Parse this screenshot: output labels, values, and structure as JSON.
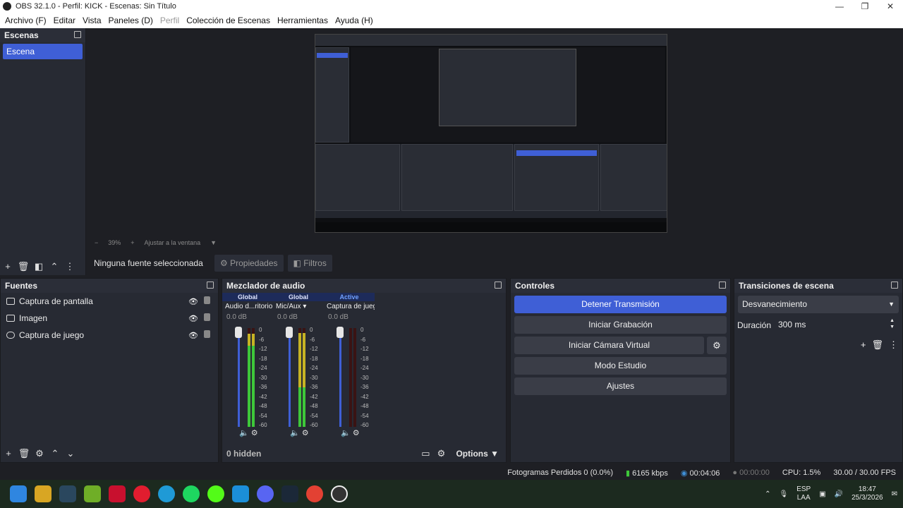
{
  "window": {
    "title": "OBS 32.1.0 - Perfil: KICK - Escenas: Sin Título",
    "controls": [
      "—",
      "❐",
      "✕"
    ]
  },
  "menu": [
    "Archivo (F)",
    "Editar",
    "Vista",
    "Paneles (D)",
    "Perfil",
    "Colección de Escenas",
    "Herramientas",
    "Ayuda (H)"
  ],
  "scenes": {
    "title": "Escenas",
    "items": [
      "Escena"
    ]
  },
  "zoom": {
    "value": "39%",
    "fit_label": "Ajustar a la ventana"
  },
  "sourcebar": {
    "no_source": "Ninguna fuente seleccionada",
    "properties": "Propiedades",
    "filters": "Filtros"
  },
  "sources": {
    "title": "Fuentes",
    "items": [
      "Captura de pantalla",
      "Imagen",
      "Captura de juego"
    ]
  },
  "mixer": {
    "title": "Mezclador de audio",
    "channels": [
      {
        "tag": "Global",
        "name": "Audio d...ritorio",
        "db": "0.0 dB",
        "level_green": 0.82,
        "level_yellow": 0.12
      },
      {
        "tag": "Global",
        "name": "Mic/Aux",
        "db": "0.0 dB",
        "level_green": 0.4,
        "level_yellow": 0.55
      },
      {
        "tag": "Active",
        "name": "Captura de juego",
        "db": "0.0 dB",
        "level_green": 0.0,
        "level_yellow": 0.0
      }
    ],
    "scale": [
      "0",
      "-6",
      "-12",
      "-18",
      "-24",
      "-30",
      "-36",
      "-42",
      "-48",
      "-54",
      "-60"
    ],
    "hidden": "0 hidden",
    "options": "Options"
  },
  "controls": {
    "title": "Controles",
    "stop_stream": "Detener Transmisión",
    "start_recording": "Iniciar Grabación",
    "virtual_cam": "Iniciar Cámara Virtual",
    "studio_mode": "Modo Estudio",
    "settings": "Ajustes"
  },
  "transitions": {
    "title": "Transiciones de escena",
    "selected": "Desvanecimiento",
    "duration_label": "Duración",
    "duration_value": "300 ms"
  },
  "status": {
    "dropped": "Fotogramas Perdidos 0 (0.0%)",
    "bitrate": "6165 kbps",
    "stream_time": "00:04:06",
    "rec_time": "00:00:00",
    "cpu": "CPU: 1.5%",
    "fps": "30.00 / 30.00 FPS"
  },
  "tray": {
    "lang_top": "ESP",
    "lang_bottom": "LAA",
    "time": "18:47",
    "date": "25/3/2026"
  },
  "colors": {
    "accent": "#3f5fd6",
    "panel": "#272a33",
    "meter_green": "#3ec83a",
    "meter_yellow": "#c7b324"
  }
}
